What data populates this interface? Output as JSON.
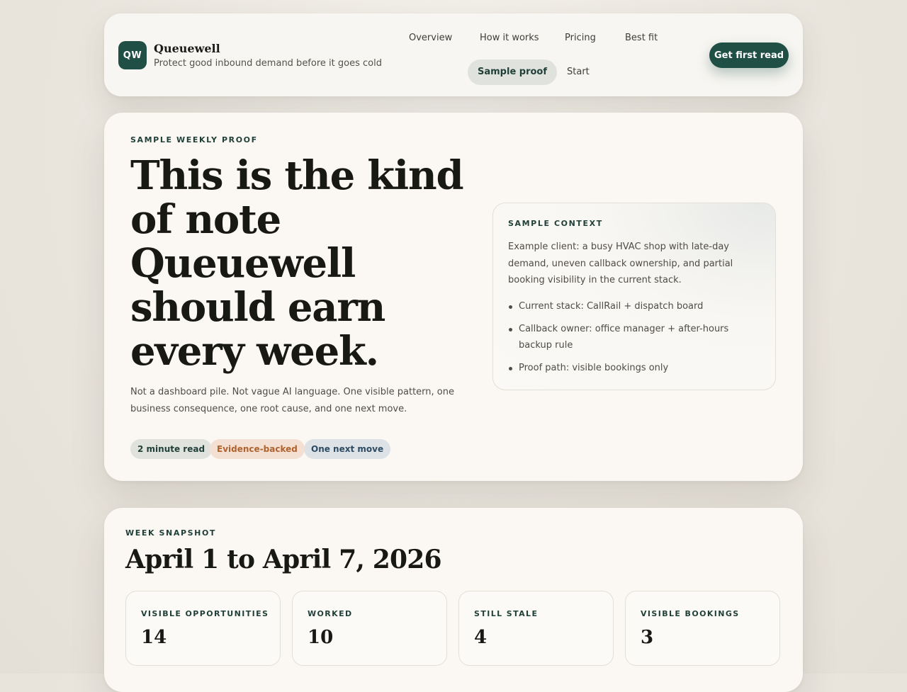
{
  "header": {
    "logo_text": "QW",
    "brand_name": "Queuewell",
    "tagline": "Protect good inbound demand before it goes cold",
    "nav": {
      "overview": "Overview",
      "how_it_works": "How it works",
      "pricing": "Pricing",
      "best_fit": "Best fit",
      "sample_proof": "Sample proof",
      "start": "Start"
    },
    "active_nav": "Sample proof",
    "cta_label": "Get first read"
  },
  "hero": {
    "eyebrow": "SAMPLE WEEKLY PROOF",
    "title": "This is the kind of note Queuewell should earn every week.",
    "description": "Not a dashboard pile. Not vague AI language. One visible pattern, one business consequence, one root cause, and one next move.",
    "pills": {
      "read_time": "2 minute read",
      "evidence": "Evidence-backed",
      "next_move": "One next move"
    }
  },
  "context": {
    "eyebrow": "SAMPLE CONTEXT",
    "text": "Example client: a busy HVAC shop with late-day demand, uneven callback ownership, and partial booking visibility in the current stack.",
    "items": [
      "Current stack: CallRail + dispatch board",
      "Callback owner: office manager + after-hours backup rule",
      "Proof path: visible bookings only"
    ]
  },
  "snapshot": {
    "eyebrow": "WEEK SNAPSHOT",
    "title": "April 1 to April 7, 2026",
    "stats": [
      {
        "label": "VISIBLE OPPORTUNITIES",
        "value": "14"
      },
      {
        "label": "WORKED",
        "value": "10"
      },
      {
        "label": "STILL STALE",
        "value": "4"
      },
      {
        "label": "VISIBLE BOOKINGS",
        "value": "3"
      }
    ]
  },
  "colors": {
    "brand": "#1f4f45",
    "background": "#ebe7df",
    "card": "#fbf8f4",
    "pill_orange_text": "#b0622d",
    "pill_blue_text": "#2d4b63"
  }
}
